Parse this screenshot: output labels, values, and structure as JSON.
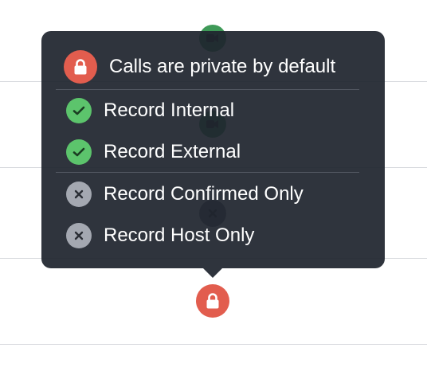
{
  "popover": {
    "title": "Calls are private by default",
    "title_icon": "lock-icon",
    "options": [
      {
        "label": "Record Internal",
        "state": "enabled",
        "icon": "check-icon"
      },
      {
        "label": "Record External",
        "state": "enabled",
        "icon": "check-icon"
      },
      {
        "label": "Record Confirmed Only",
        "state": "disabled",
        "icon": "x-icon"
      },
      {
        "label": "Record Host Only",
        "state": "disabled",
        "icon": "x-icon"
      }
    ]
  },
  "trigger": {
    "icon": "lock-icon",
    "state": "private"
  },
  "colors": {
    "popover_bg": "#1f252e",
    "lock_red": "#e25d4e",
    "check_green": "#5cc46c",
    "x_gray": "#a4a8b1",
    "row_line": "#d6d8dc"
  }
}
